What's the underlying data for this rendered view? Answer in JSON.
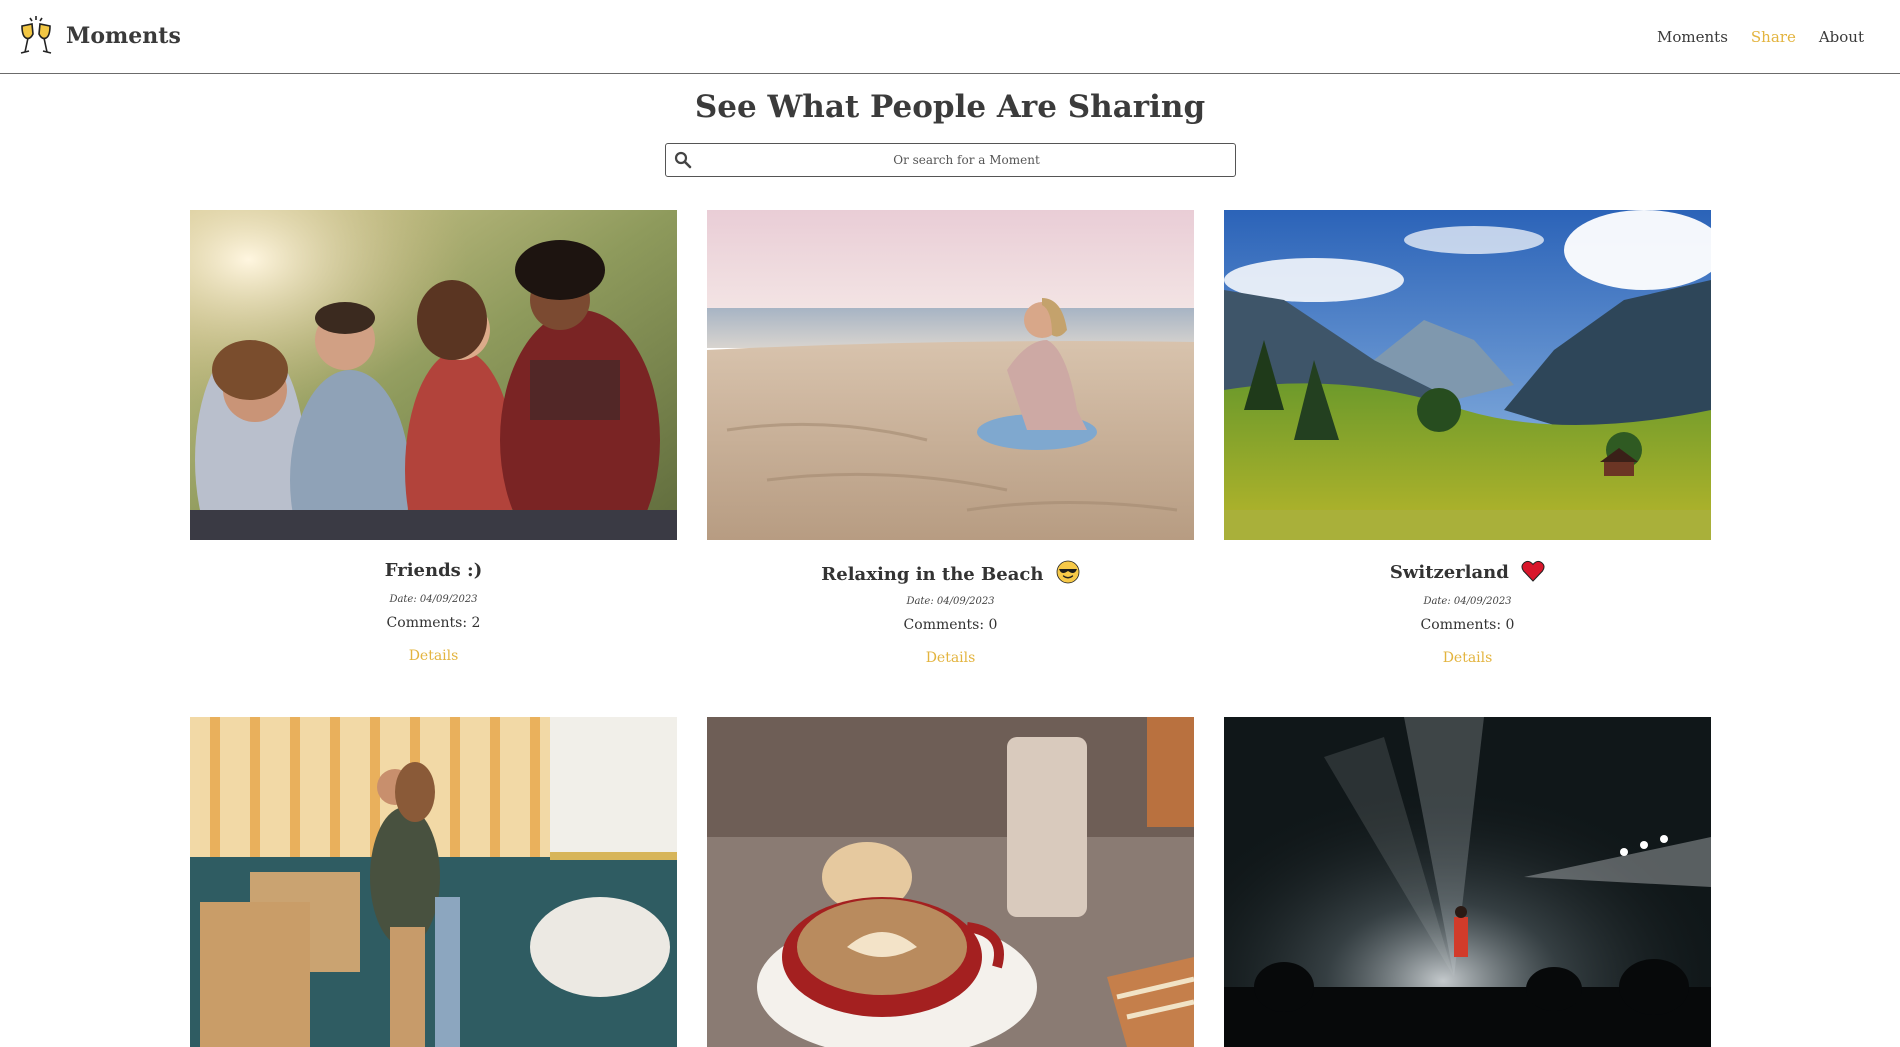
{
  "header": {
    "brand_name": "Moments",
    "nav": [
      {
        "label": "Moments"
      },
      {
        "label": "Share"
      },
      {
        "label": "About"
      }
    ],
    "accent_color": "#e3b43f"
  },
  "hero": {
    "title": "See What People Are Sharing",
    "search": {
      "placeholder": "Or search for a Moment",
      "value": "",
      "icon": "search-icon"
    }
  },
  "cards": [
    {
      "title": "Friends :)",
      "emoji": "",
      "date": "Date: 04/09/2023",
      "comments": "Comments: 2",
      "details": "Details",
      "image": "friends-photo"
    },
    {
      "title": "Relaxing in the Beach",
      "emoji": "sunglasses-emoji",
      "date": "Date: 04/09/2023",
      "comments": "Comments: 0",
      "details": "Details",
      "image": "beach-photo"
    },
    {
      "title": "Switzerland",
      "emoji": "heart-emoji",
      "date": "Date: 04/09/2023",
      "comments": "Comments: 0",
      "details": "Details",
      "image": "mountains-photo"
    },
    {
      "image": "couple-photo"
    },
    {
      "image": "coffee-photo"
    },
    {
      "image": "concert-photo"
    }
  ]
}
